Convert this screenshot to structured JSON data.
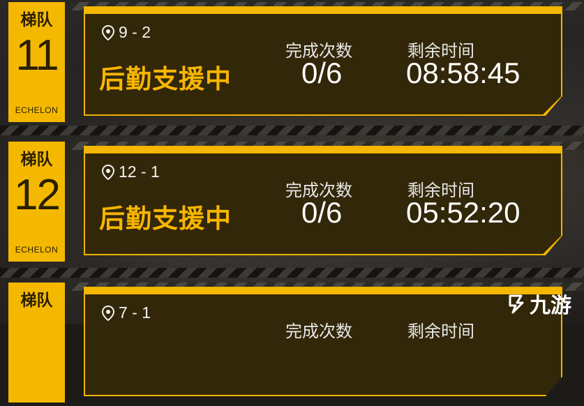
{
  "rows": [
    {
      "label": "梯队",
      "number": "11",
      "sub": "ECHELON",
      "location": "9 - 2",
      "status": "后勤支援中",
      "count_label": "完成次数",
      "count": "0/6",
      "time_label": "剩余时间",
      "time": "08:58:45"
    },
    {
      "label": "梯队",
      "number": "12",
      "sub": "ECHELON",
      "location": "12 - 1",
      "status": "后勤支援中",
      "count_label": "完成次数",
      "count": "0/6",
      "time_label": "剩余时间",
      "time": "05:52:20"
    },
    {
      "label": "梯队",
      "number": "",
      "sub": "",
      "location": "7 - 1",
      "status": "",
      "count_label": "完成次数",
      "count": "",
      "time_label": "剩余时间",
      "time": ""
    }
  ],
  "watermark": {
    "text": "九游",
    "icon": "jiuyou-logo-icon"
  },
  "colors": {
    "accent": "#f5b800",
    "panel": "#332709",
    "status_text": "#f7b600"
  }
}
